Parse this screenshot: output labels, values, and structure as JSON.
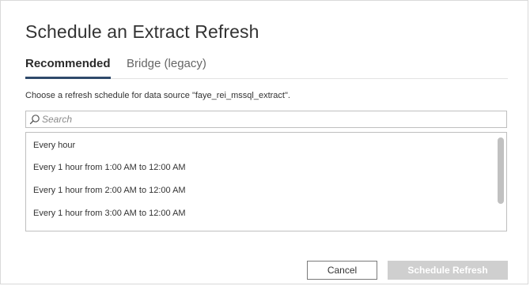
{
  "dialog": {
    "title": "Schedule an Extract Refresh"
  },
  "tabs": [
    {
      "label": "Recommended",
      "active": true
    },
    {
      "label": "Bridge (legacy)",
      "active": false
    }
  ],
  "description": "Choose a refresh schedule for data source \"faye_rei_mssql_extract\".",
  "search": {
    "placeholder": "Search",
    "value": "",
    "icon": "search-icon"
  },
  "schedules": [
    {
      "label": "Every hour"
    },
    {
      "label": "Every 1 hour from 1:00 AM to 12:00 AM"
    },
    {
      "label": "Every 1 hour from 2:00 AM to 12:00 AM"
    },
    {
      "label": "Every 1 hour from 3:00 AM to 12:00 AM"
    }
  ],
  "buttons": {
    "cancel": "Cancel",
    "schedule": "Schedule Refresh"
  },
  "colors": {
    "tab_underline": "#2f4a6b",
    "primary_disabled": "#cfcfcf",
    "text": "#333333"
  }
}
